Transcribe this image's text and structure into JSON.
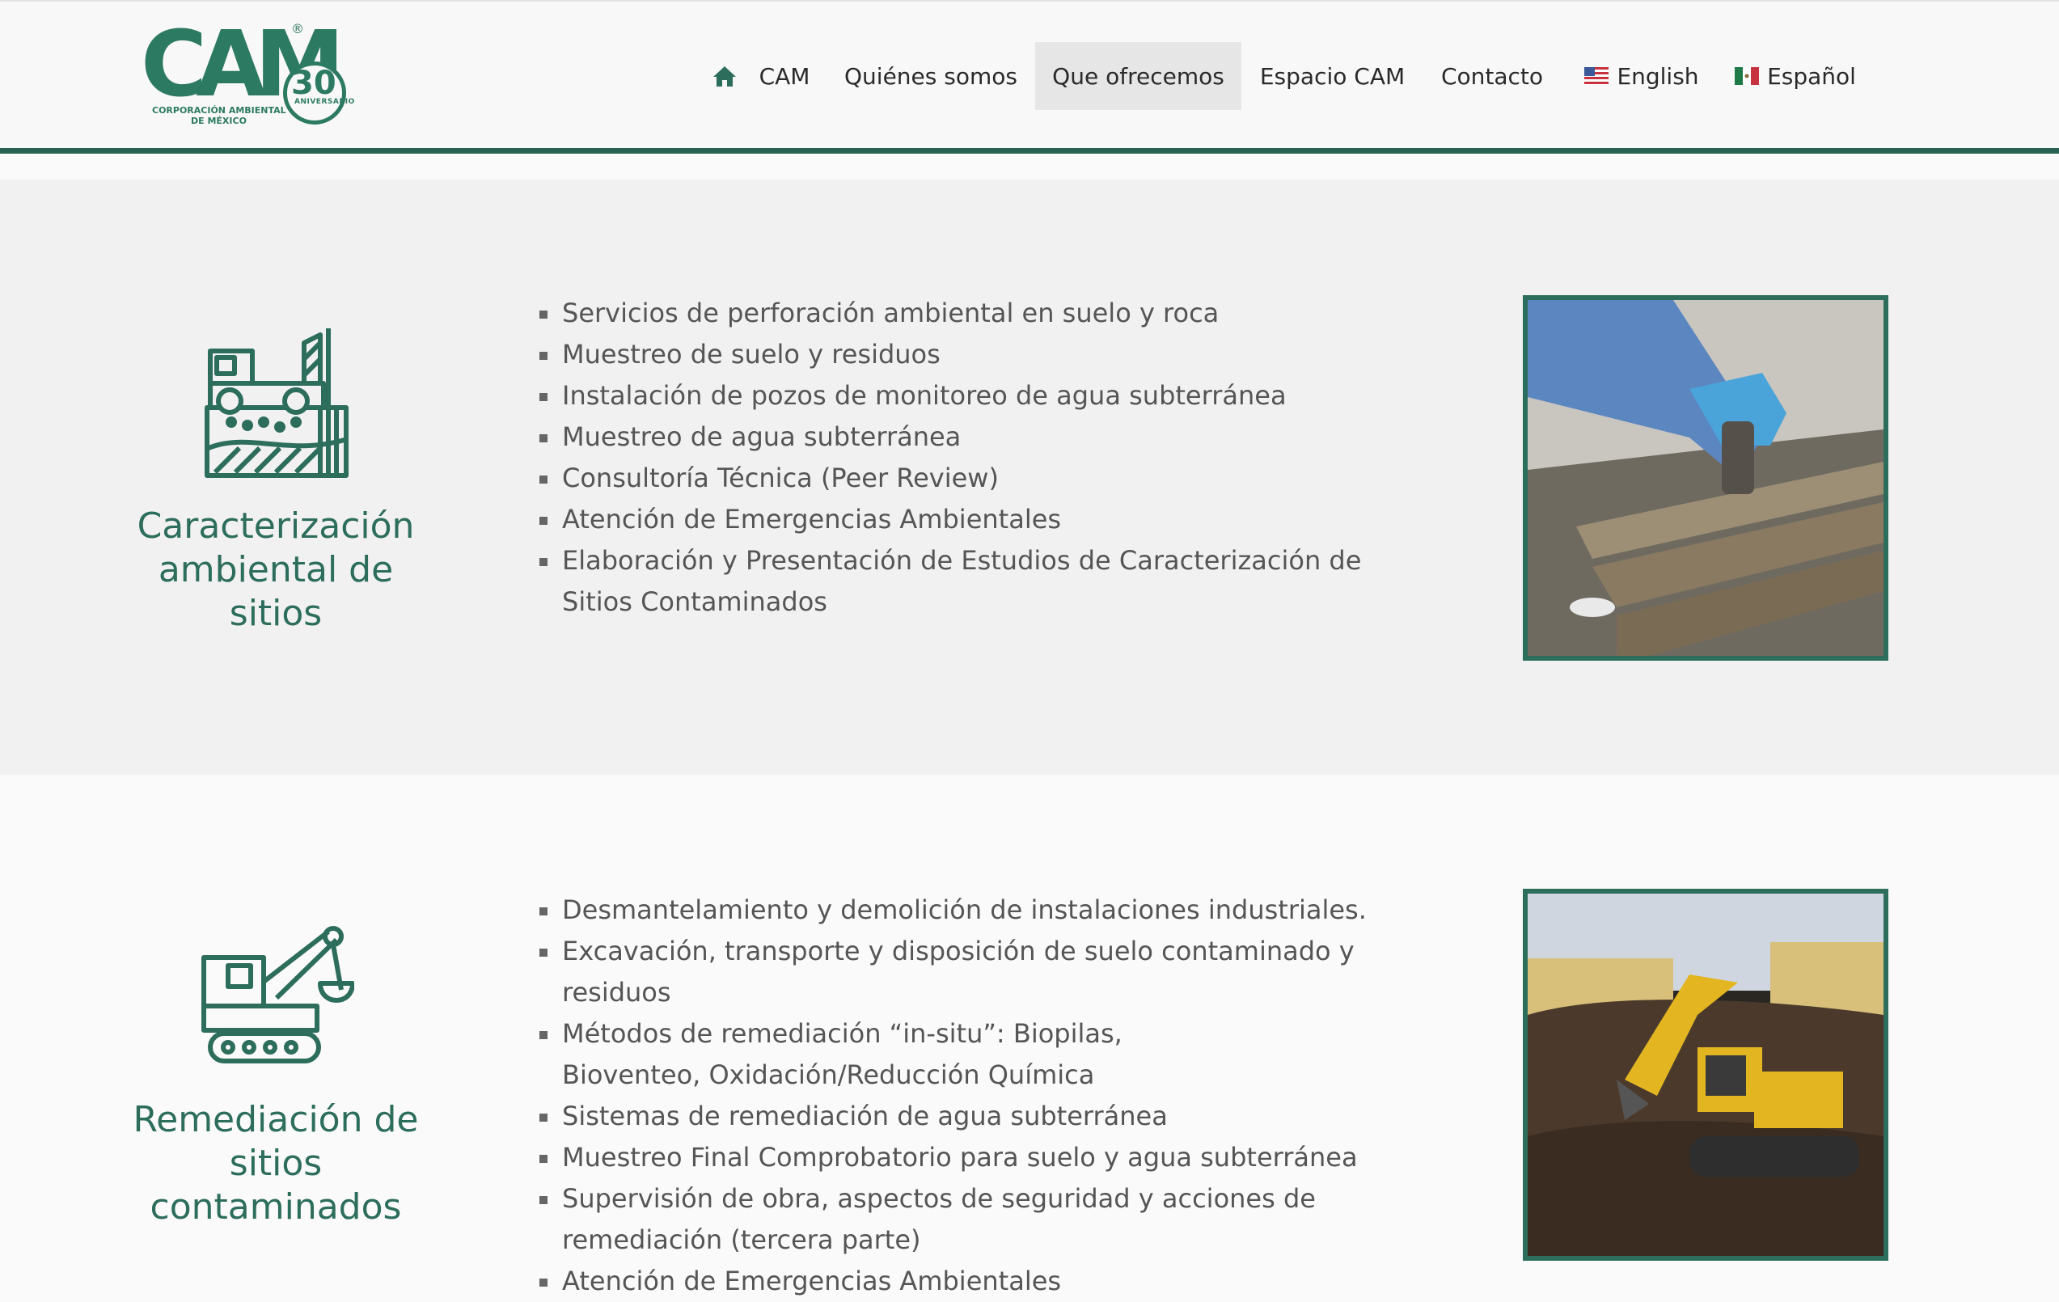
{
  "header": {
    "logo": {
      "brand": "CAM",
      "registered": "®",
      "anniversary_number": "30",
      "anniversary_label": "ANIVERSARIO",
      "subtitle_line1": "CORPORACIÓN AMBIENTAL",
      "subtitle_line2": "DE MÉXICO"
    },
    "nav": [
      {
        "label": "CAM",
        "icon": "home-icon"
      },
      {
        "label": "Quiénes somos"
      },
      {
        "label": "Que ofrecemos",
        "active": true
      },
      {
        "label": "Espacio CAM"
      },
      {
        "label": "Contacto"
      },
      {
        "label": "English",
        "icon": "us-flag-icon"
      },
      {
        "label": "Español",
        "icon": "mx-flag-icon"
      }
    ]
  },
  "services": [
    {
      "icon": "drilling-rig-icon",
      "title_lines": [
        "Caracterización",
        "ambiental de",
        "sitios"
      ],
      "items": [
        "Servicios de perforación ambiental en suelo y roca",
        "Muestreo de suelo y residuos",
        "Instalación de pozos de monitoreo de agua subterránea",
        "Muestreo de agua subterránea",
        "Consultoría Técnica (Peer Review)",
        "Atención de Emergencias Ambientales",
        "Elaboración y Presentación de Estudios de Caracterización de Sitios Contaminados"
      ],
      "photo": "soil-sampling-photo"
    },
    {
      "icon": "excavator-icon",
      "title_lines": [
        "Remediación de",
        "sitios",
        "contaminados"
      ],
      "items": [
        "Desmantelamiento y demolición de instalaciones industriales.",
        "Excavación, transporte y disposición de suelo contaminado y residuos",
        "Métodos de remediación “in-situ”: Biopilas, Bioventeo, Oxidación/Reducción Química",
        "Sistemas de remediación de agua subterránea",
        "Muestreo Final Comprobatorio para suelo y agua subterránea",
        "Supervisión de obra, aspectos de seguridad y acciones de remediación (tercera parte)",
        "Atención de Emergencias Ambientales"
      ],
      "photo": "excavator-photo"
    }
  ],
  "colors": {
    "brand_green": "#2d6d5c",
    "header_rule": "#2a6253",
    "active_nav_bg": "#e6e6e6"
  }
}
